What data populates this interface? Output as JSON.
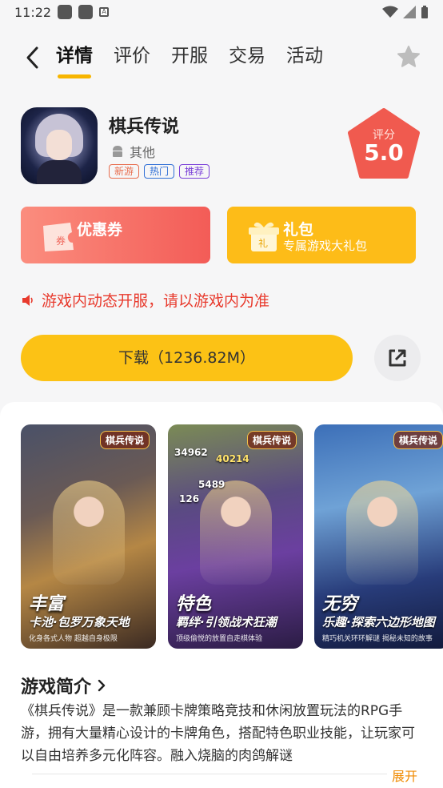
{
  "status_bar": {
    "time": "11:22"
  },
  "nav": {
    "tabs": [
      {
        "label": "详情",
        "active": true
      },
      {
        "label": "评价",
        "active": false
      },
      {
        "label": "开服",
        "active": false
      },
      {
        "label": "交易",
        "active": false
      },
      {
        "label": "活动",
        "active": false
      }
    ],
    "icons": {
      "back": "back-arrow-icon",
      "favorite": "star-icon"
    }
  },
  "app": {
    "name": "棋兵传说",
    "platform": "其他",
    "tags": [
      "新游",
      "热门",
      "推荐"
    ],
    "score_label": "评分",
    "score": "5.0"
  },
  "cards": {
    "coupon": {
      "title": "优惠券",
      "badge": "券"
    },
    "gift": {
      "title": "礼包",
      "subtitle": "专属游戏大礼包",
      "badge": "礼"
    }
  },
  "notice": "游戏内动态开服，请以游戏内为准",
  "download_label": "下载（1236.82M）",
  "screenshots": [
    {
      "logo": "棋兵传说",
      "headline": "丰富",
      "subline": "卡池·包罗万象天地",
      "caption": "化身各式人物  超越自身极限"
    },
    {
      "logo": "棋兵传说",
      "headline": "特色",
      "subline": "羁绊·引领战术狂潮",
      "caption": "顶级偷悦的放置自走棋体验",
      "numbers": [
        "34962",
        "40214",
        "5489",
        "126"
      ]
    },
    {
      "logo": "棋兵传说",
      "headline": "无穷",
      "subline": "乐趣·探索六边形地图",
      "caption": "精巧机关环环解谜  揭秘未知的故事"
    }
  ],
  "intro": {
    "title": "游戏简介",
    "text": "《棋兵传说》是一款兼顾卡牌策略竞技和休闲放置玩法的RPG手游，拥有大量精心设计的卡牌角色，搭配特色职业技能，让玩家可以自由培养多元化阵容。融入烧脑的肉鸽解谜",
    "expand_label": "展开"
  },
  "colors": {
    "accent": "#fcc215",
    "tab_underline": "#f7b500",
    "notice": "#e83a2d",
    "coupon_start": "#fb8d7e",
    "coupon_end": "#f35c57",
    "gift": "#fdbc18",
    "score_badge": "#f05a4f",
    "expand": "#f08a00"
  }
}
